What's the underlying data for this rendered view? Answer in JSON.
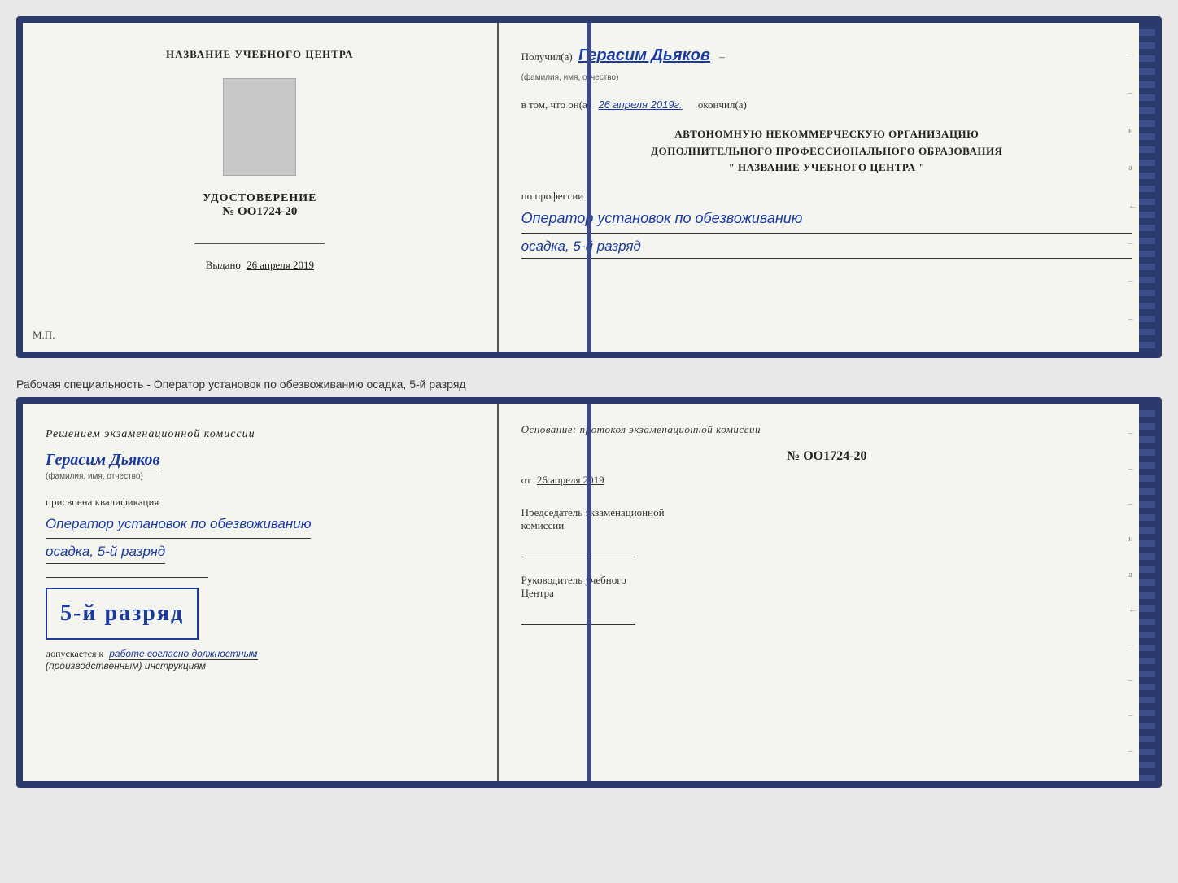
{
  "top_document": {
    "left": {
      "title": "НАЗВАНИЕ УЧЕБНОГО ЦЕНТРА",
      "photo_alt": "photo placeholder",
      "cert_label": "УДОСТОВЕРЕНИЕ",
      "cert_number": "№ OO1724-20",
      "issued_label": "Выдано",
      "issued_date": "26 апреля 2019",
      "mp_label": "М.П."
    },
    "right": {
      "recipient_prefix": "Получил(а)",
      "recipient_name": "Герасим Дьяков",
      "recipient_hint": "(фамилия, имя, отчество)",
      "vtom_prefix": "в том, что он(а)",
      "vtom_date": "26 апреля 2019г.",
      "okончил": "окончил(а)",
      "org_line1": "АВТОНОМНУЮ НЕКОММЕРЧЕСКУЮ ОРГАНИЗАЦИЮ",
      "org_line2": "ДОПОЛНИТЕЛЬНОГО ПРОФЕССИОНАЛЬНОГО ОБРАЗОВАНИЯ",
      "org_line3": "\"  НАЗВАНИЕ УЧЕБНОГО ЦЕНТРА  \"",
      "po_professii": "по профессии",
      "profession_line1": "Оператор установок по обезвоживанию",
      "profession_line2": "осадка, 5-й разряд"
    }
  },
  "info_text": "Рабочая специальность - Оператор установок по обезвоживанию осадка, 5-й разряд",
  "bottom_document": {
    "left": {
      "resheniem": "Решением экзаменационной комиссии",
      "person_name": "Герасим Дьяков",
      "person_hint": "(фамилия, имя, отчество)",
      "prisvoena": "присвоена квалификация",
      "kvali_line1": "Оператор установок по обезвоживанию",
      "kvali_line2": "осадка, 5-й разряд",
      "stamp_razryad": "5-й разряд",
      "dopuskaetsya_prefix": "допускается к",
      "dopuskaetsya_text": "работе согласно должностным",
      "dopuskaetsya_line2": "(производственным) инструкциям"
    },
    "right": {
      "osnovanie": "Основание: протокол экзаменационной комиссии",
      "protocol_number": "№ OO1724-20",
      "ot_prefix": "от",
      "ot_date": "26 апреля 2019",
      "predsedatel_line1": "Председатель экзаменационной",
      "predsedatel_line2": "комиссии",
      "rukovoditel_line1": "Руководитель учебного",
      "rukovoditel_line2": "Центра"
    }
  },
  "side_markers": {
    "items": [
      "и",
      "а",
      "←",
      "–",
      "–",
      "–",
      "–",
      "–"
    ]
  }
}
